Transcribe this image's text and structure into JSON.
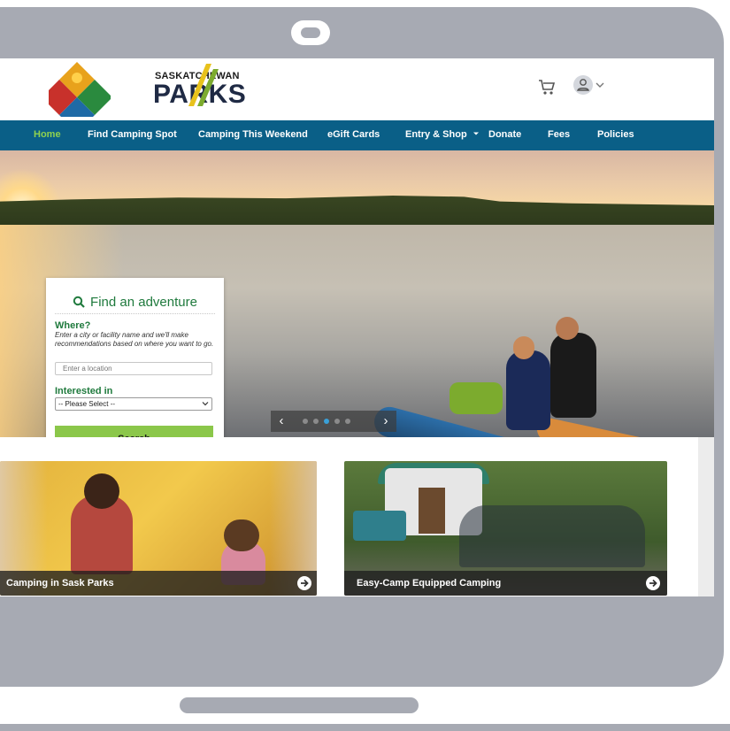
{
  "brand": {
    "line1": "SASKATCHEWAN",
    "line2": "PARKS",
    "colors": {
      "nav": "#0a5f87",
      "accent": "#8bc74a",
      "green_text": "#1f7a3d",
      "active_nav": "#8fd14f"
    }
  },
  "header": {
    "cart_icon": "cart-icon",
    "account_icon": "user-icon"
  },
  "nav": {
    "items": [
      {
        "label": "Home",
        "active": true
      },
      {
        "label": "Find Camping Spot"
      },
      {
        "label": "Camping This Weekend"
      },
      {
        "label": "eGift Cards"
      },
      {
        "label": "Entry & Shop"
      },
      {
        "label": "Donate"
      },
      {
        "label": "Fees"
      },
      {
        "label": "Policies"
      }
    ]
  },
  "finder": {
    "title": "Find an adventure",
    "where_label": "Where?",
    "where_help": "Enter a city or facility name and we'll make recommendations based on where you want to go.",
    "location_placeholder": "Enter a location",
    "interest_label": "Interested in",
    "interest_value": "-- Please Select --",
    "search_label": "Search"
  },
  "carousel": {
    "prev": "‹",
    "next": "›",
    "slides": 5,
    "active_slide": 2
  },
  "cards": [
    {
      "title": "Camping in Sask Parks"
    },
    {
      "title": "Easy-Camp Equipped Camping"
    }
  ]
}
